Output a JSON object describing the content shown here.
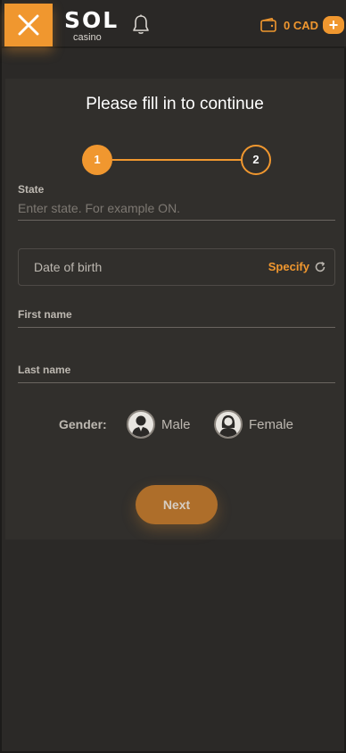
{
  "header": {
    "brand": "SOL",
    "brand_sub": "casino",
    "balance": "0 CAD",
    "add_label": "+",
    "icons": [
      "close-icon",
      "bell-icon",
      "wallet-icon"
    ]
  },
  "form": {
    "title": "Please fill in to continue",
    "steps": [
      "1",
      "2"
    ],
    "current_step": 1,
    "state": {
      "label": "State",
      "placeholder": "Enter state. For example ON.",
      "value": ""
    },
    "dob": {
      "label": "Date of birth",
      "action": "Specify"
    },
    "first_name": {
      "label": "First name",
      "value": ""
    },
    "last_name": {
      "label": "Last name",
      "value": ""
    },
    "gender": {
      "label": "Gender:",
      "options": [
        "Male",
        "Female"
      ],
      "selected": null
    },
    "next_label": "Next"
  },
  "colors": {
    "accent": "#f0972f",
    "background": "#2b2927",
    "card": "#312f2c"
  }
}
